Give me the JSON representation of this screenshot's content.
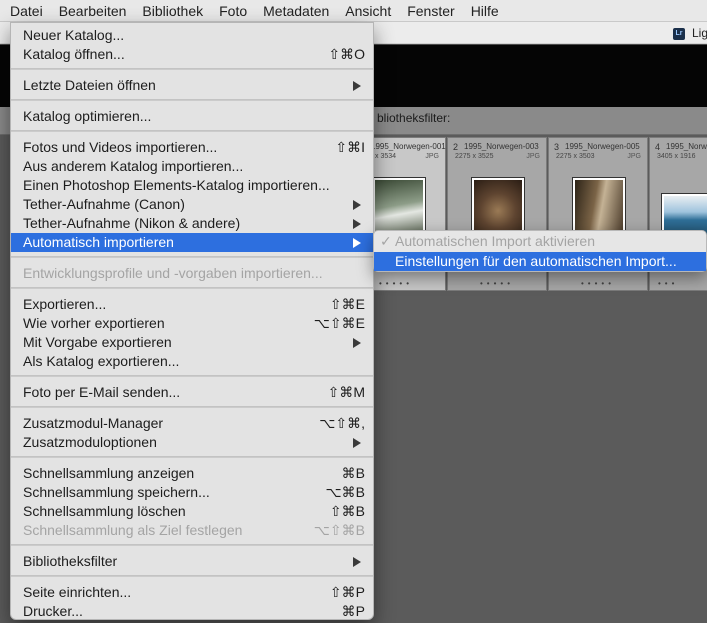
{
  "menubar": [
    {
      "label": "Datei",
      "active": true
    },
    {
      "label": "Bearbeiten"
    },
    {
      "label": "Bibliothek"
    },
    {
      "label": "Foto"
    },
    {
      "label": "Metadaten"
    },
    {
      "label": "Ansicht"
    },
    {
      "label": "Fenster"
    },
    {
      "label": "Hilfe"
    }
  ],
  "app": {
    "badge": "Lr",
    "window_title_fragment": "Lig",
    "filter_bar_label": "bliotheksfilter:"
  },
  "grid": [
    {
      "num": "",
      "name": "1995_Norwegen-001",
      "dims": "x 3534",
      "type": "JPG",
      "selected": true
    },
    {
      "num": "2",
      "name": "1995_Norwegen-003",
      "dims": "2275 x 3525",
      "type": "JPG"
    },
    {
      "num": "3",
      "name": "1995_Norwegen-005",
      "dims": "2275 x 3503",
      "type": "JPG"
    },
    {
      "num": "4",
      "name": "1995_Norw",
      "dims": "3405 x 1916",
      "type": ""
    }
  ],
  "menu": {
    "items": [
      {
        "label": "Neuer Katalog..."
      },
      {
        "label": "Katalog öffnen...",
        "shortcut": "⇧⌘O"
      },
      {
        "sep": true
      },
      {
        "label": "Letzte Dateien öffnen",
        "submenu": true
      },
      {
        "sep": true
      },
      {
        "label": "Katalog optimieren..."
      },
      {
        "sep": true
      },
      {
        "label": "Fotos und Videos importieren...",
        "shortcut": "⇧⌘I"
      },
      {
        "label": "Aus anderem Katalog importieren..."
      },
      {
        "label": "Einen Photoshop Elements-Katalog importieren..."
      },
      {
        "label": "Tether-Aufnahme (Canon)",
        "submenu": true
      },
      {
        "label": "Tether-Aufnahme (Nikon & andere)",
        "submenu": true
      },
      {
        "label": "Automatisch importieren",
        "submenu": true,
        "highlighted": true
      },
      {
        "sep": true
      },
      {
        "label": "Entwicklungsprofile und -vorgaben importieren...",
        "disabled": true
      },
      {
        "sep": true
      },
      {
        "label": "Exportieren...",
        "shortcut": "⇧⌘E"
      },
      {
        "label": "Wie vorher exportieren",
        "shortcut": "⌥⇧⌘E"
      },
      {
        "label": "Mit Vorgabe exportieren",
        "submenu": true
      },
      {
        "label": "Als Katalog exportieren..."
      },
      {
        "sep": true
      },
      {
        "label": "Foto per E-Mail senden...",
        "shortcut": "⇧⌘M"
      },
      {
        "sep": true
      },
      {
        "label": "Zusatzmodul-Manager",
        "shortcut": "⌥⇧⌘,"
      },
      {
        "label": "Zusatzmoduloptionen",
        "submenu": true
      },
      {
        "sep": true
      },
      {
        "label": "Schnellsammlung anzeigen",
        "shortcut": "⌘B"
      },
      {
        "label": "Schnellsammlung speichern...",
        "shortcut": "⌥⌘B"
      },
      {
        "label": "Schnellsammlung löschen",
        "shortcut": "⇧⌘B"
      },
      {
        "label": "Schnellsammlung als Ziel festlegen",
        "shortcut": "⌥⇧⌘B",
        "disabled": true
      },
      {
        "sep": true
      },
      {
        "label": "Bibliotheksfilter",
        "submenu": true
      },
      {
        "sep": true
      },
      {
        "label": "Seite einrichten...",
        "shortcut": "⇧⌘P"
      },
      {
        "label": "Drucker...",
        "shortcut": "⌘P"
      }
    ]
  },
  "submenu": {
    "items": [
      {
        "label": "Automatischen Import aktivieren",
        "checked": true,
        "disabled": true
      },
      {
        "label": "Einstellungen für den automatischen Import...",
        "highlighted": true
      }
    ]
  }
}
